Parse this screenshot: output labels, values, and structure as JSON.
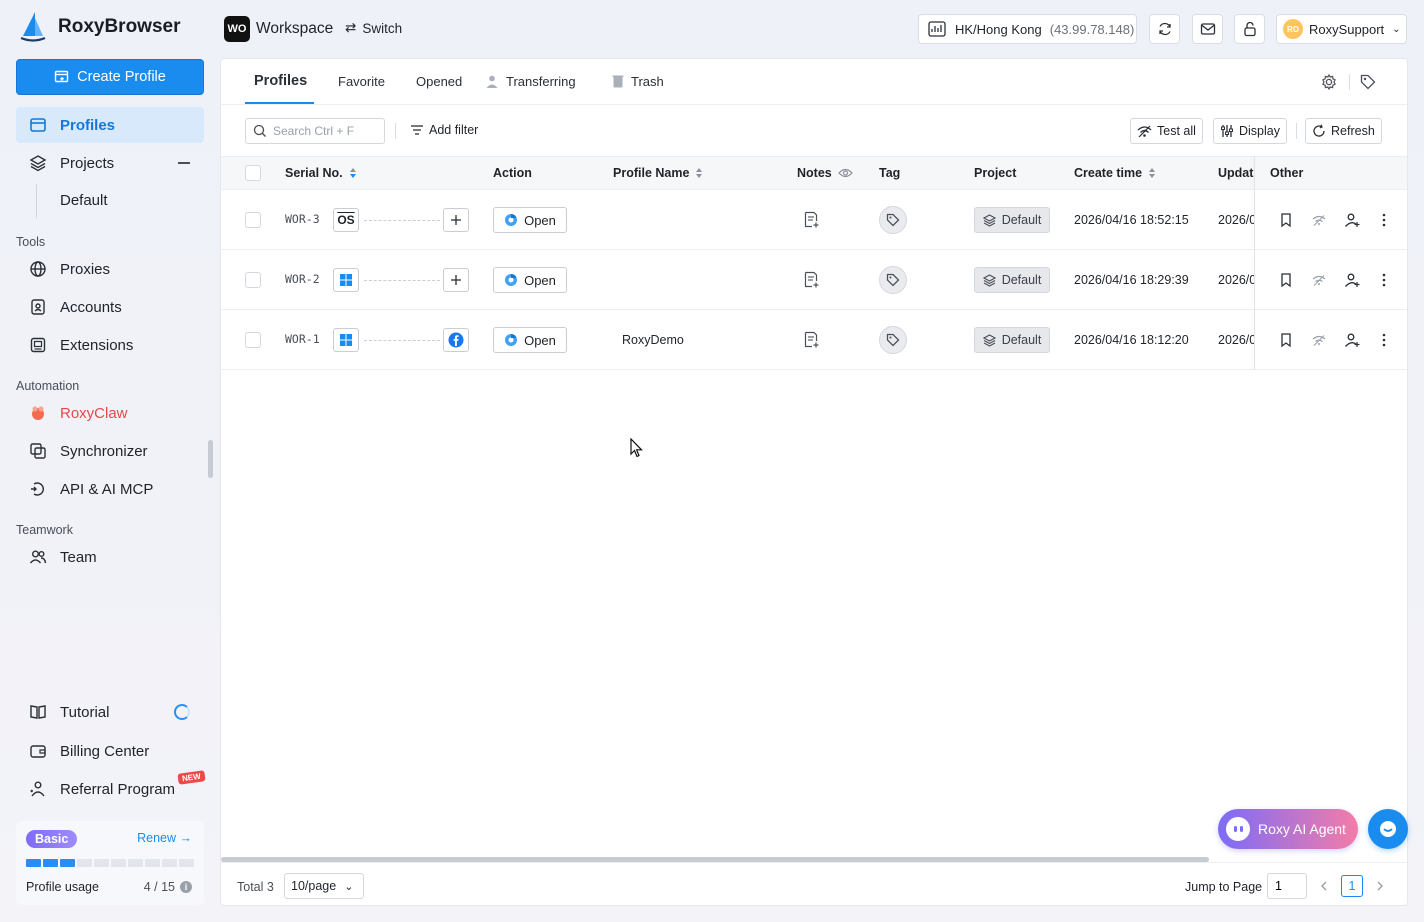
{
  "brand": {
    "name": "RoxyBrowser"
  },
  "sidebar": {
    "create_label": "Create Profile",
    "profiles_label": "Profiles",
    "projects_label": "Projects",
    "projects_sub": "Default",
    "sections": {
      "tools": "Tools",
      "automation": "Automation",
      "teamwork": "Teamwork"
    },
    "tools": [
      "Proxies",
      "Accounts",
      "Extensions"
    ],
    "automation": [
      "RoxyClaw",
      "Synchronizer",
      "API & AI MCP"
    ],
    "teamwork": [
      "Team"
    ],
    "bottom": [
      "Tutorial",
      "Billing Center",
      "Referral Program"
    ],
    "new_badge": "NEW",
    "plan": {
      "name": "Basic",
      "renew": "Renew",
      "usage_label": "Profile usage",
      "usage_count": "4 / 15",
      "used": 4,
      "total": 15
    }
  },
  "topbar": {
    "workspace_badge": "WO",
    "workspace_name": "Workspace",
    "switch_label": "Switch",
    "proxy_location": "HK/Hong Kong",
    "proxy_ip": "(43.99.78.148)",
    "user_initials": "RO",
    "user_name": "RoxySupport"
  },
  "tabs": [
    "Profiles",
    "Favorite",
    "Opened",
    "Transferring",
    "Trash"
  ],
  "toolbar": {
    "search_placeholder": "Search Ctrl + F",
    "add_filter": "Add filter",
    "test_all": "Test all",
    "display": "Display",
    "refresh": "Refresh"
  },
  "table": {
    "columns": [
      "Serial No.",
      "Action",
      "Profile Name",
      "Notes",
      "Tag",
      "Project",
      "Create time",
      "Updat",
      "Other"
    ],
    "open_label": "Open",
    "rows": [
      {
        "serial": "WOR-3",
        "os": "macOS",
        "platform": "none",
        "name": "",
        "project": "Default",
        "created": "2026/04/16 18:52:15",
        "updated": "2026/0"
      },
      {
        "serial": "WOR-2",
        "os": "Windows",
        "platform": "none",
        "name": "",
        "project": "Default",
        "created": "2026/04/16 18:29:39",
        "updated": "2026/0"
      },
      {
        "serial": "WOR-1",
        "os": "Windows",
        "platform": "facebook",
        "name": "RoxyDemo",
        "project": "Default",
        "created": "2026/04/16 18:12:20",
        "updated": "2026/0"
      }
    ]
  },
  "footer": {
    "total": "Total 3",
    "per_page": "10/page",
    "jump_label": "Jump to Page",
    "jump_value": "1",
    "current_page": "1"
  },
  "floating": {
    "ai_agent": "Roxy AI Agent"
  },
  "colors": {
    "accent": "#1a8cf0",
    "active_nav_bg": "#d8e9fb",
    "roxyclaw": "#e5484d"
  }
}
